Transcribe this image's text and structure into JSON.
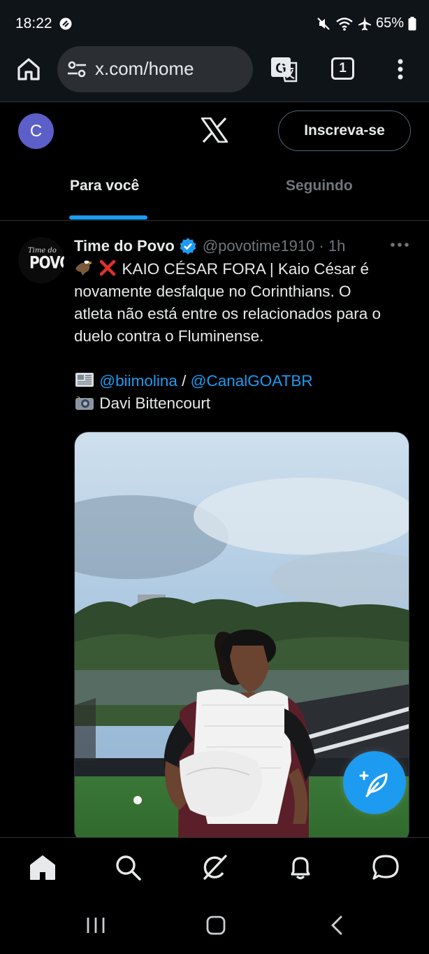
{
  "status_bar": {
    "time": "18:22",
    "battery": "65%"
  },
  "browser": {
    "url": "x.com/home",
    "tab_count": "1"
  },
  "header": {
    "avatar_letter": "C",
    "signup_label": "Inscreva-se",
    "tabs": [
      {
        "label": "Para você",
        "active": true
      },
      {
        "label": "Seguindo",
        "active": false
      }
    ]
  },
  "tweet": {
    "avatar_text_top": "Time do",
    "avatar_text_bottom": "POVO",
    "author_name": "Time do Povo",
    "handle_time": "@povotime1910 · 1h",
    "lines": {
      "l1": "KAIO CÉSAR FORA | Kaio César é",
      "l2": "novamente desfalque no Corinthians. O",
      "l3": "atleta não está entre os relacionados para o",
      "l4": "duelo contra o Fluminense."
    },
    "mention1": "@biimolina",
    "separator": " / ",
    "mention2": "@CanalGOATBR",
    "credit": "Davi Bittencourt"
  },
  "icons": {
    "accent": "#1d9bf0",
    "nav": [
      "home-icon",
      "search-icon",
      "grok-icon",
      "notifications-icon",
      "messages-icon"
    ]
  }
}
